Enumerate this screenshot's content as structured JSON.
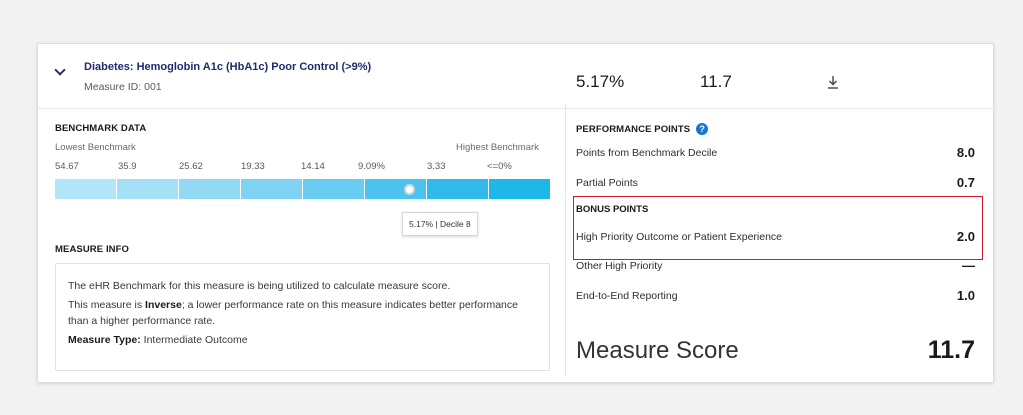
{
  "measure": {
    "title": "Diabetes: Hemoglobin A1c (HbA1c) Poor Control (>9%)",
    "id_label": "Measure ID: 001",
    "performance_rate": "5.17%",
    "score": "11.7"
  },
  "benchmark": {
    "heading": "BENCHMARK DATA",
    "lowest_label": "Lowest Benchmark",
    "highest_label": "Highest Benchmark",
    "ticks": [
      "54.67",
      "35.9",
      "25.62",
      "19.33",
      "14.14",
      "9.09%",
      "3.33",
      "<=0%"
    ],
    "bar_color": "#1fb6ea",
    "bar_light_color": "#a9e2f6",
    "tooltip": "5.17% | Decile 8"
  },
  "measure_info": {
    "heading": "MEASURE INFO",
    "line1": "The eHR Benchmark for this measure is being utilized to calculate measure score.",
    "line2_pre": "This measure is ",
    "line2_bold": "Inverse",
    "line2_post": "; a lower performance rate on this measure indicates better performance than a higher performance rate.",
    "type_label": "Measure Type:",
    "type_value": " Intermediate Outcome"
  },
  "performance_points": {
    "heading": "PERFORMANCE POINTS",
    "help_icon": "question-circle-icon",
    "rows": [
      {
        "label": "Points from Benchmark Decile",
        "value": "8.0"
      },
      {
        "label": "Partial Points",
        "value": "0.7"
      }
    ],
    "bonus_heading": "BONUS POINTS",
    "bonus_rows": [
      {
        "label": "High Priority Outcome or Patient Experience",
        "value": "2.0"
      },
      {
        "label": "Other High Priority",
        "value": "—"
      },
      {
        "label": "End-to-End Reporting",
        "value": "1.0"
      }
    ],
    "highlight_color": "#d11a25"
  },
  "measure_score": {
    "label": "Measure Score",
    "value": "11.7"
  }
}
